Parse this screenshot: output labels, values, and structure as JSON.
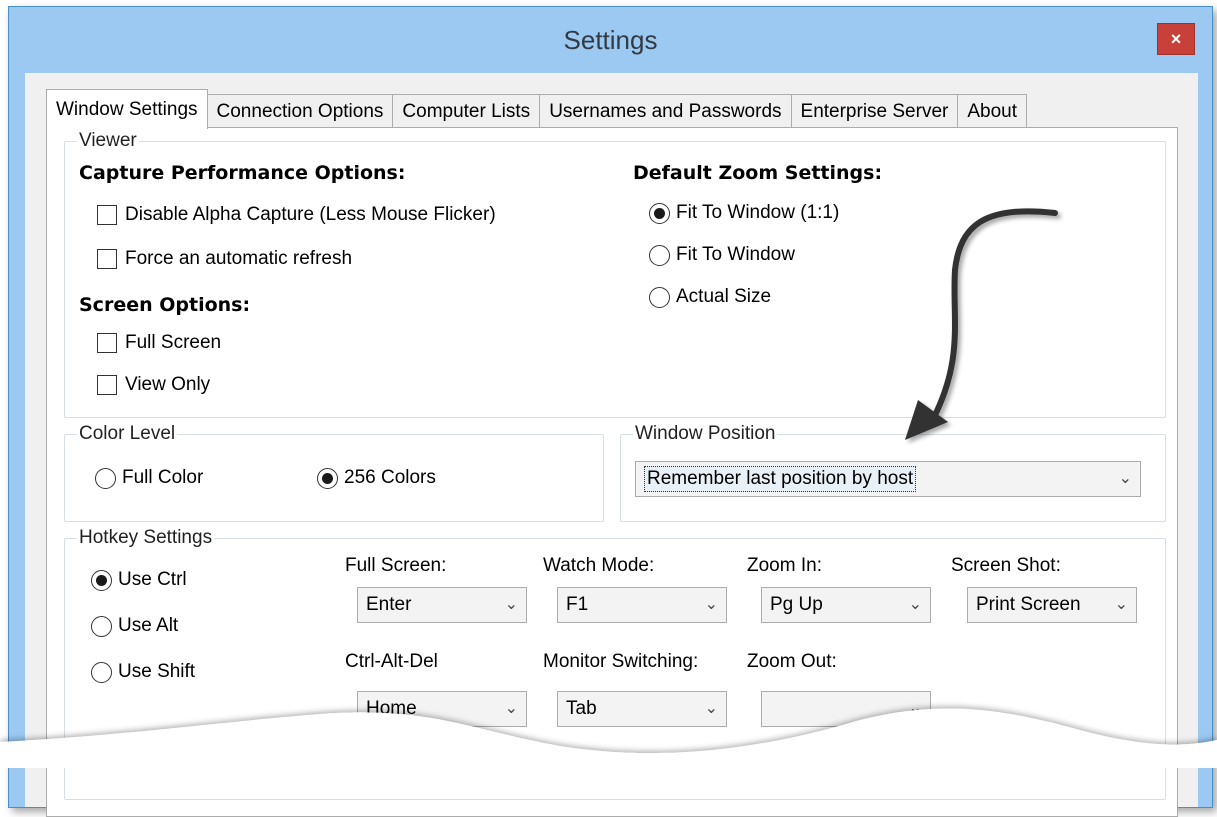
{
  "window": {
    "title": "Settings",
    "close_glyph": "×"
  },
  "tabs": [
    {
      "label": "Window Settings",
      "active": true
    },
    {
      "label": "Connection Options"
    },
    {
      "label": "Computer Lists"
    },
    {
      "label": "Usernames and Passwords"
    },
    {
      "label": "Enterprise Server"
    },
    {
      "label": "About"
    }
  ],
  "viewer": {
    "group_title": "Viewer",
    "capture_heading": "Capture Performance Options:",
    "disable_alpha": "Disable Alpha Capture (Less Mouse Flicker)",
    "force_refresh": "Force an automatic refresh",
    "screen_heading": "Screen Options:",
    "full_screen": "Full Screen",
    "view_only": "View Only",
    "zoom_heading": "Default Zoom Settings:",
    "zoom_fit_1to1": "Fit To Window (1:1)",
    "zoom_fit": "Fit To Window",
    "zoom_actual": "Actual Size"
  },
  "color_level": {
    "group_title": "Color Level",
    "full_color": "Full Color",
    "colors_256": "256 Colors"
  },
  "window_position": {
    "group_title": "Window Position",
    "selected": "Remember last position by host"
  },
  "hotkeys": {
    "group_title": "Hotkey Settings",
    "use_ctrl": "Use Ctrl",
    "use_alt": "Use Alt",
    "use_shift": "Use Shift",
    "partial_text": "...oom",
    "full_screen_label": "Full Screen:",
    "full_screen_value": "Enter",
    "watch_mode_label": "Watch Mode:",
    "watch_mode_value": "F1",
    "zoom_in_label": "Zoom In:",
    "zoom_in_value": "Pg Up",
    "screen_shot_label": "Screen Shot:",
    "screen_shot_value": "Print Screen",
    "ctrl_alt_del_label": "Ctrl-Alt-Del",
    "ctrl_alt_del_value": "Home",
    "monitor_switching_label": "Monitor Switching:",
    "monitor_switching_value": "Tab",
    "zoom_out_label": "Zoom Out:"
  },
  "colors": {
    "titlebar": "#9bc9f2",
    "close": "#c7403a",
    "group_border": "#d5dfe5"
  }
}
